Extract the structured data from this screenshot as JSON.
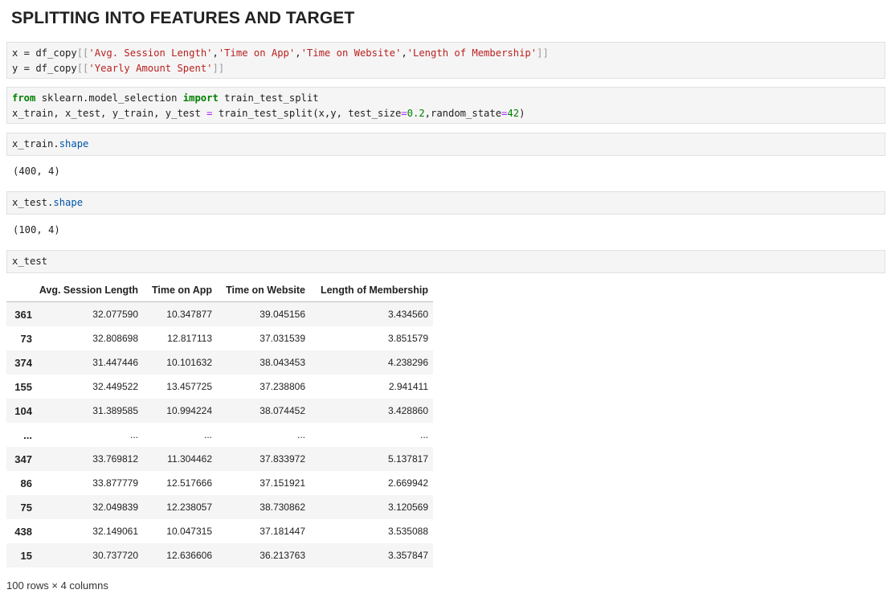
{
  "heading": "SPLITTING INTO FEATURES AND TARGET",
  "cell1": {
    "l1_a": "x = df_copy",
    "l1_b": "[[",
    "l1_c": "'Avg. Session Length'",
    "l1_d": ",",
    "l1_e": "'Time on App'",
    "l1_f": ",",
    "l1_g": "'Time on Website'",
    "l1_h": ",",
    "l1_i": "'Length of Membership'",
    "l1_j": "]]",
    "l2_a": "y = df_copy",
    "l2_b": "[[",
    "l2_c": "'Yearly Amount Spent'",
    "l2_d": "]]"
  },
  "cell2": {
    "l1_from": "from",
    "l1_mod": " sklearn.model_selection ",
    "l1_import": "import",
    "l1_name": " train_test_split",
    "l2_a": "x_train, x_test, y_train, y_test ",
    "l2_eq": "=",
    "l2_b": " train_test_split(x,y, test_size",
    "l2_eq2": "=",
    "l2_n1": "0.2",
    "l2_c": ",random_state",
    "l2_eq3": "=",
    "l2_n2": "42",
    "l2_d": ")"
  },
  "cell3": {
    "obj": "x_train.",
    "attr": "shape"
  },
  "out3": "(400, 4)",
  "cell4": {
    "obj": "x_test.",
    "attr": "shape"
  },
  "out4": "(100, 4)",
  "cell5": {
    "code": "x_test"
  },
  "table": {
    "columns": [
      "Avg. Session Length",
      "Time on App",
      "Time on Website",
      "Length of Membership"
    ],
    "rows": [
      {
        "idx": "361",
        "v": [
          "32.077590",
          "10.347877",
          "39.045156",
          "3.434560"
        ]
      },
      {
        "idx": "73",
        "v": [
          "32.808698",
          "12.817113",
          "37.031539",
          "3.851579"
        ]
      },
      {
        "idx": "374",
        "v": [
          "31.447446",
          "10.101632",
          "38.043453",
          "4.238296"
        ]
      },
      {
        "idx": "155",
        "v": [
          "32.449522",
          "13.457725",
          "37.238806",
          "2.941411"
        ]
      },
      {
        "idx": "104",
        "v": [
          "31.389585",
          "10.994224",
          "38.074452",
          "3.428860"
        ]
      },
      {
        "idx": "...",
        "v": [
          "...",
          "...",
          "...",
          "..."
        ]
      },
      {
        "idx": "347",
        "v": [
          "33.769812",
          "11.304462",
          "37.833972",
          "5.137817"
        ]
      },
      {
        "idx": "86",
        "v": [
          "33.877779",
          "12.517666",
          "37.151921",
          "2.669942"
        ]
      },
      {
        "idx": "75",
        "v": [
          "32.049839",
          "12.238057",
          "38.730862",
          "3.120569"
        ]
      },
      {
        "idx": "438",
        "v": [
          "32.149061",
          "10.047315",
          "37.181447",
          "3.535088"
        ]
      },
      {
        "idx": "15",
        "v": [
          "30.737720",
          "12.636606",
          "36.213763",
          "3.357847"
        ]
      }
    ]
  },
  "footer": "100 rows × 4 columns"
}
